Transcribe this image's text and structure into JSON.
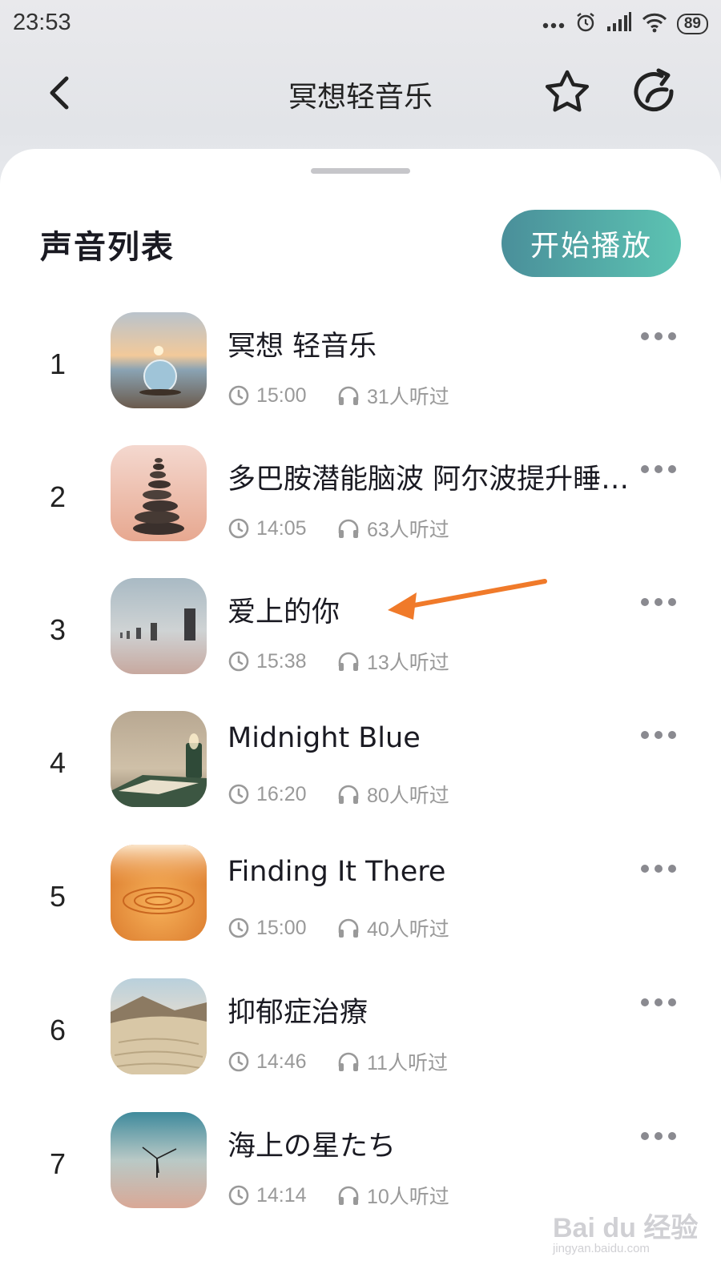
{
  "status_bar": {
    "time": "23:53",
    "battery": "89"
  },
  "header": {
    "title": "冥想轻音乐"
  },
  "sheet": {
    "list_title": "声音列表",
    "play_all_label": "开始播放"
  },
  "tracks": [
    {
      "number": "1",
      "title": "冥想 轻音乐",
      "duration": "15:00",
      "listens": "31人听过"
    },
    {
      "number": "2",
      "title": "多巴胺潜能脑波 阿尔波提升睡…",
      "duration": "14:05",
      "listens": "63人听过"
    },
    {
      "number": "3",
      "title": "爱上的你",
      "duration": "15:38",
      "listens": "13人听过"
    },
    {
      "number": "4",
      "title": "Midnight Blue",
      "duration": "16:20",
      "listens": "80人听过"
    },
    {
      "number": "5",
      "title": "Finding It There",
      "duration": "15:00",
      "listens": "40人听过"
    },
    {
      "number": "6",
      "title": "抑郁症治療",
      "duration": "14:46",
      "listens": "11人听过"
    },
    {
      "number": "7",
      "title": "海上の星たち",
      "duration": "14:14",
      "listens": "10人听过"
    }
  ],
  "annotation": {
    "color": "#f07a2a"
  },
  "watermark": {
    "text": "Bai du 经验",
    "sub": "jingyan.baidu.com"
  },
  "colors": {
    "accent_start": "#4a8f9a",
    "accent_end": "#5cc3b2",
    "title_underline": "#f5cc7a"
  },
  "icons": [
    "back-arrow-icon",
    "star-icon",
    "share-icon",
    "clock-icon",
    "headphones-icon",
    "more-icon"
  ]
}
